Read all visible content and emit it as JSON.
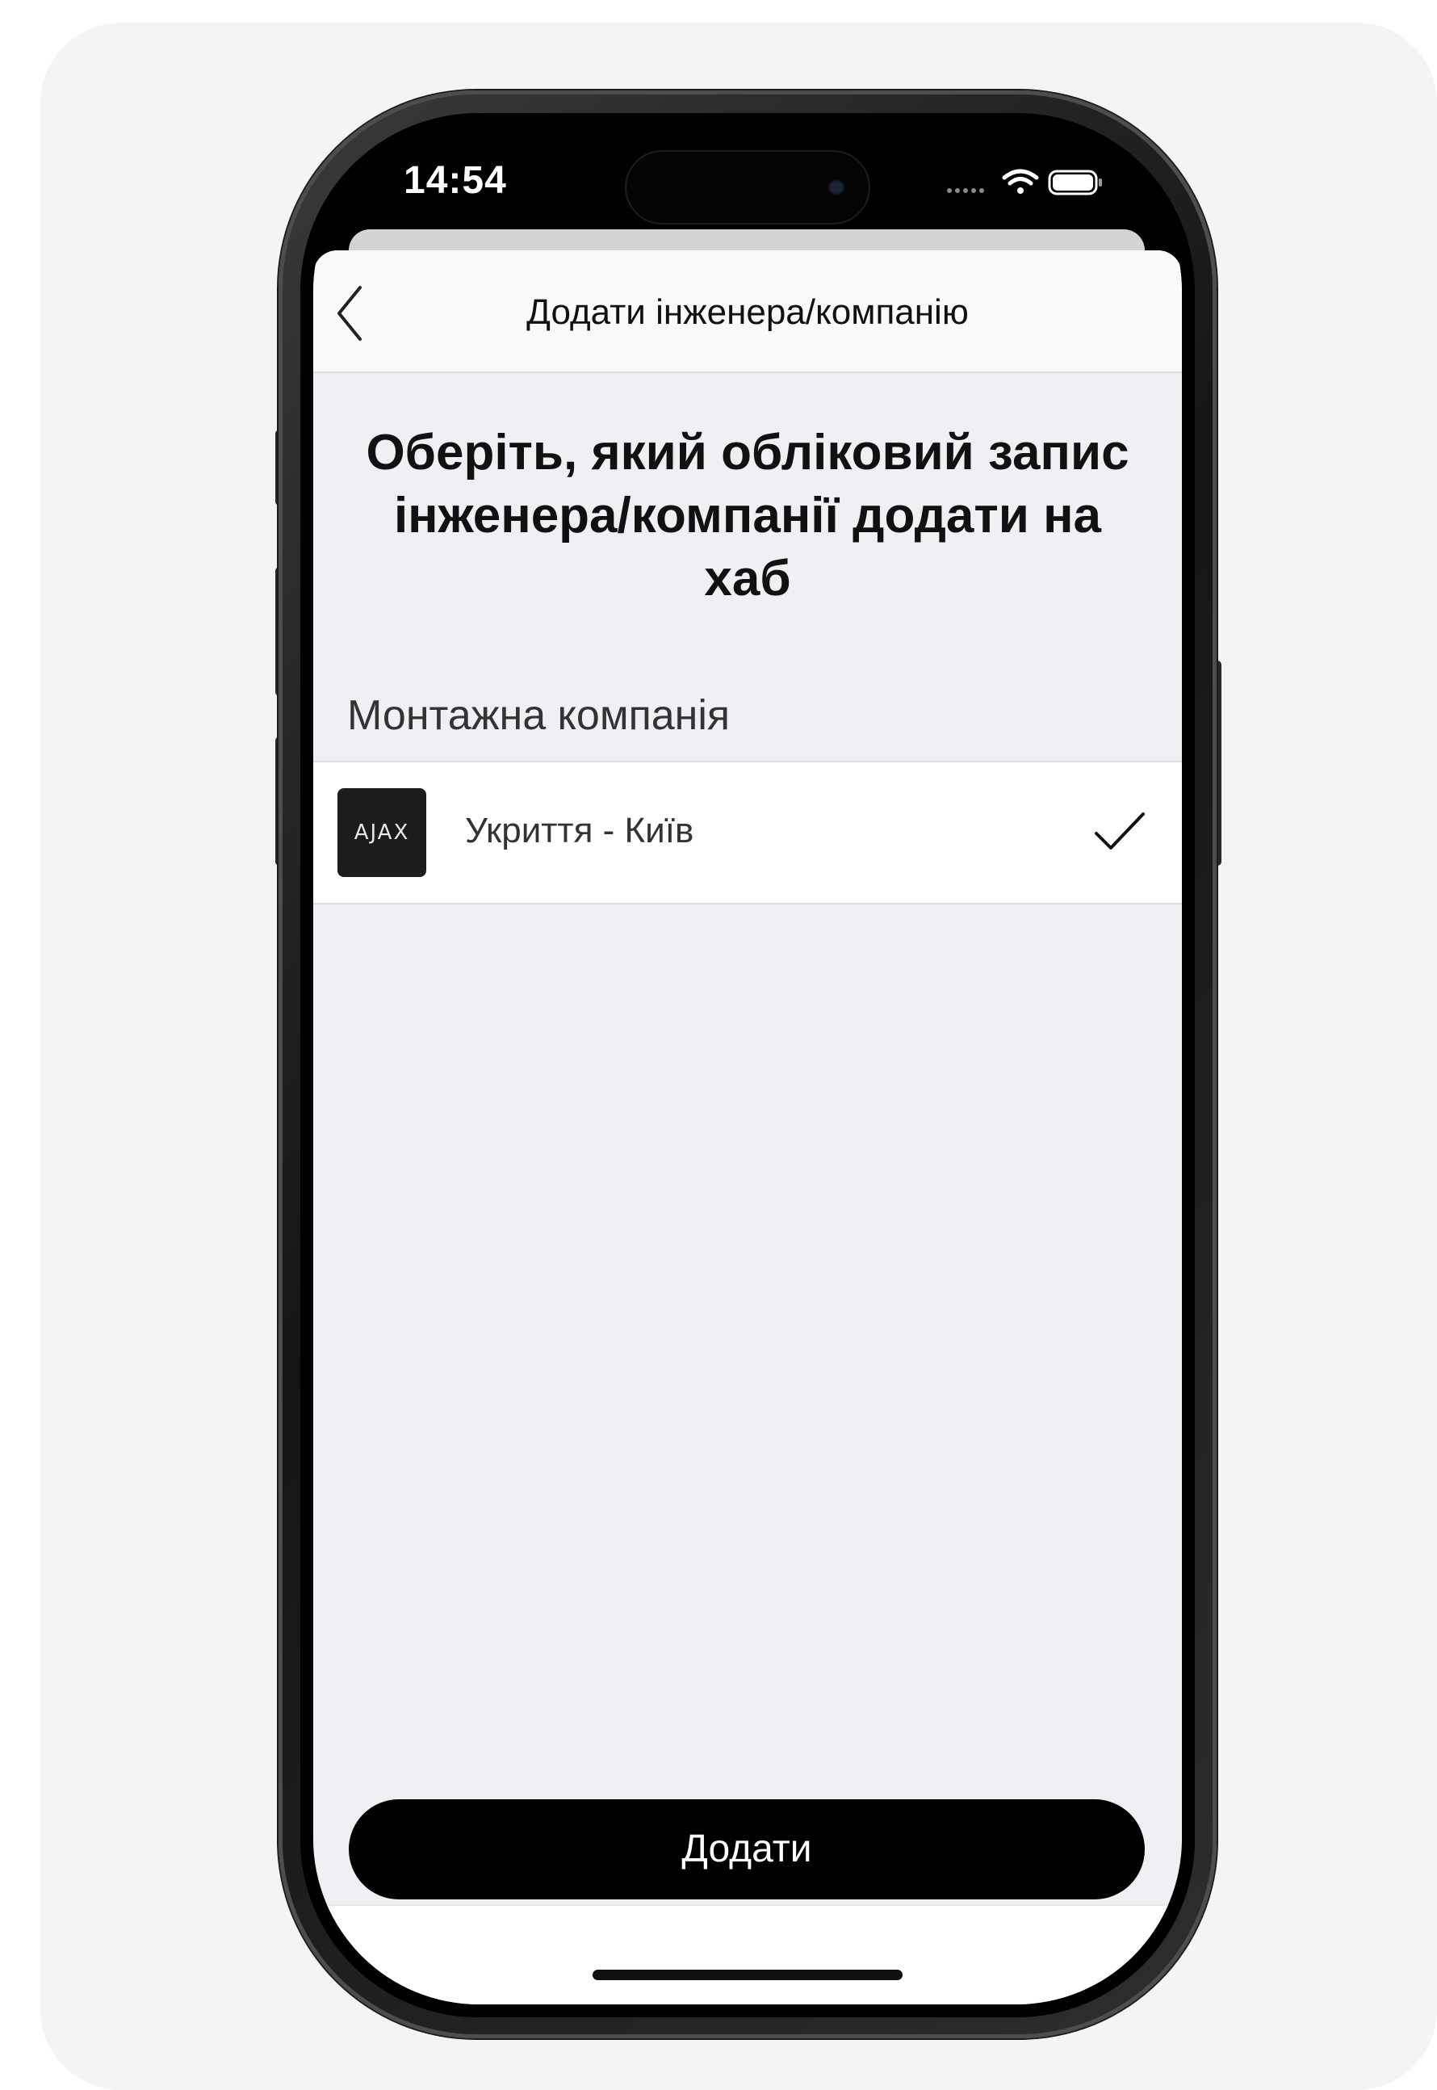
{
  "status_bar": {
    "time": "14:54",
    "icons": [
      "dots-icon",
      "wifi-icon",
      "battery-icon"
    ]
  },
  "nav": {
    "back_icon": "chevron-left-icon",
    "title": "Додати інженера/компанію"
  },
  "main": {
    "heading": "Оберіть, який обліковий запис інженера/компанії додати на хаб",
    "section_label": "Монтажна компанія",
    "companies": [
      {
        "logo_text": "AJAX",
        "name": "Укриття - Київ",
        "selected": true
      }
    ]
  },
  "footer": {
    "add_label": "Додати"
  },
  "colors": {
    "page_bg": "#f4f4f5",
    "sheet_bg": "#efeff4",
    "button_bg": "#000000",
    "button_text": "#ffffff"
  }
}
